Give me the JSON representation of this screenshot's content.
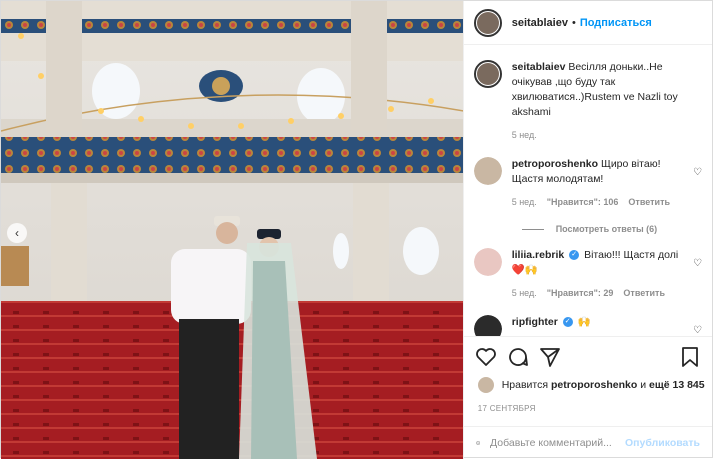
{
  "post": {
    "author": "seitablaiev",
    "dot": "•",
    "follow_label": "Подписаться",
    "caption": "Весілля доньки..Не очікував ,що буду так хвилюватися..)Rustem ve Nazli toy akshami",
    "caption_time": "5 нед.",
    "likes_prefix": "Нравится",
    "likes_user": "petroporoshenko",
    "likes_and": "и",
    "likes_more": "ещё 13 845",
    "date": "17 СЕНТЯБРЯ",
    "add_comment_placeholder": "Добавьте комментарий...",
    "publish_label": "Опубликовать"
  },
  "comments": [
    {
      "user": "petroporoshenko",
      "text": "Щиро вітаю! Щастя молодятам!",
      "time": "5 нед.",
      "likes": "\"Нравится\": 106",
      "reply": "Ответить",
      "view_replies": "Посмотреть ответы (6)",
      "avatar_color": "#c9b7a3"
    },
    {
      "user": "liliia.rebrik",
      "text": "Вітаю!!! Щастя долі ❤️🙌",
      "time": "5 нед.",
      "likes": "\"Нравится\": 29",
      "reply": "Ответить",
      "avatar_color": "#e9c7c2"
    },
    {
      "user": "ripfighter",
      "text": "🙌",
      "avatar_color": "#2b2b2b"
    }
  ],
  "colors": {
    "link": "#0095f6",
    "muted": "#8e8e8e",
    "verified": "#3897f0"
  }
}
